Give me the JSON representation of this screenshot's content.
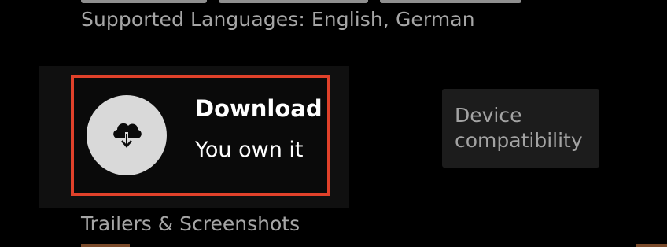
{
  "details": {
    "languages_text": "Supported Languages: English, German"
  },
  "download": {
    "title": "Download",
    "status": "You own it",
    "icon": "cloud-download-icon",
    "highlight_color": "#e0412a"
  },
  "device_compatibility": {
    "label": "Device compatibility"
  },
  "trailers": {
    "heading": "Trailers & Screenshots"
  }
}
